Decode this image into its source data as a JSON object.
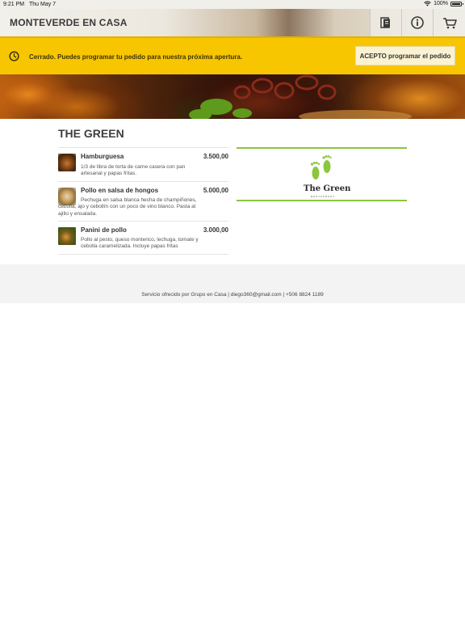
{
  "status_bar": {
    "time": "9:21 PM",
    "date": "Thu May 7",
    "battery": "100%",
    "icons": [
      "wifi-icon",
      "battery-icon"
    ]
  },
  "header": {
    "title": "MONTEVERDE EN CASA",
    "buttons": [
      {
        "icon": "menu-book-icon"
      },
      {
        "icon": "info-icon"
      },
      {
        "icon": "cart-icon"
      }
    ]
  },
  "notice": {
    "icon": "clock-icon",
    "message": "Cerrado. Puedes programar tu pedido para nuestra próxima apertura.",
    "accept_label": "ACEPTO programar el pedido",
    "color": "#f8c600"
  },
  "restaurant": {
    "name": "THE GREEN",
    "logo_text": "The Green",
    "logo_sub": "RESTAURANT",
    "accent": "#8cc63f"
  },
  "menu": {
    "items": [
      {
        "name": "Hamburguesa",
        "price": "3.500,00",
        "description": "1/3 de libra de torta de carne casera con pan artesanal y papas fritas."
      },
      {
        "name": "Pollo en salsa de hongos",
        "price": "5.000,00",
        "description": "Pechuga en salsa blanca hecha de champiñones, cebolla, ajo y cebollín con un poco de vino blanco. Pasta al ajillo y ensalada."
      },
      {
        "name": "Panini de pollo",
        "price": "3.000,00",
        "description": "Pollo al pesto, queso monterico, lechuga, tomate y cebolla caramelizada. Incluye papas fritas"
      }
    ]
  },
  "footer": {
    "text": "Servicio ofrecido por Grupo en Casa | diego360@gmail.com | +506 8824 1189"
  }
}
